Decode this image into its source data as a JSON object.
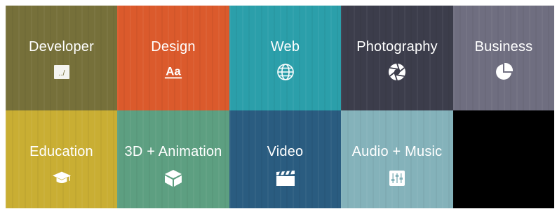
{
  "tiles": [
    {
      "id": "developer",
      "label": "Developer",
      "icon": "terminal-icon",
      "color": "#76703a"
    },
    {
      "id": "design",
      "label": "Design",
      "icon": "typography-icon",
      "color": "#db5a2c"
    },
    {
      "id": "web",
      "label": "Web",
      "icon": "globe-icon",
      "color": "#2b9faa"
    },
    {
      "id": "photography",
      "label": "Photography",
      "icon": "aperture-icon",
      "color": "#3c3d4b"
    },
    {
      "id": "business",
      "label": "Business",
      "icon": "pie-chart-icon",
      "color": "#6f6e80"
    },
    {
      "id": "education",
      "label": "Education",
      "icon": "graduation-cap-icon",
      "color": "#c9ae33"
    },
    {
      "id": "3d-animation",
      "label": "3D + Animation",
      "icon": "cube-icon",
      "color": "#5d9f81"
    },
    {
      "id": "video",
      "label": "Video",
      "icon": "clapperboard-icon",
      "color": "#2a5c80"
    },
    {
      "id": "audio-music",
      "label": "Audio + Music",
      "icon": "mixer-sliders-icon",
      "color": "#84b2ba"
    }
  ],
  "blank_color": "#000000",
  "icon_text": {
    "developer": "../",
    "design": "Aa"
  }
}
